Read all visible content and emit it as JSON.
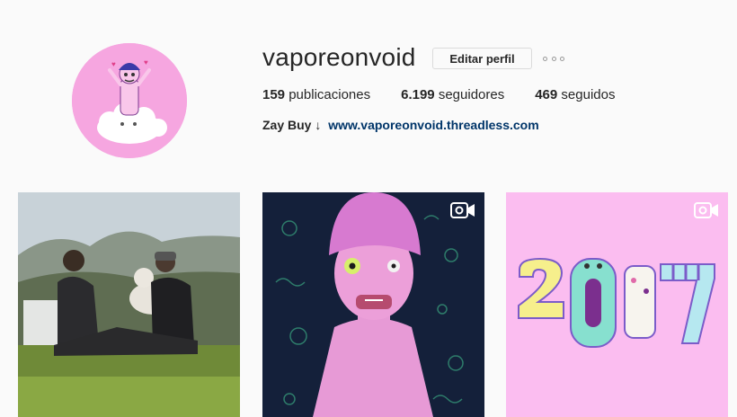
{
  "profile": {
    "username": "vaporeonvoid",
    "edit_label": "Editar perfil",
    "more_icon": "ellipsis-icon"
  },
  "stats": {
    "posts_count": "159",
    "posts_label": "publicaciones",
    "followers_count": "6.199",
    "followers_label": "seguidores",
    "following_count": "469",
    "following_label": "seguidos"
  },
  "bio": {
    "name": "Zay Buy ↓",
    "link": "www.vaporeonvoid.threadless.com"
  },
  "posts": [
    {
      "kind": "photo",
      "description_icon": "photo-tile"
    },
    {
      "kind": "video",
      "video_icon": "video-camera-icon"
    },
    {
      "kind": "video",
      "video_icon": "video-camera-icon"
    }
  ],
  "colors": {
    "background": "#fafafa",
    "link": "#003569",
    "avatar_pink": "#f6a6e0",
    "tile3_pink": "#fbbdf0"
  }
}
